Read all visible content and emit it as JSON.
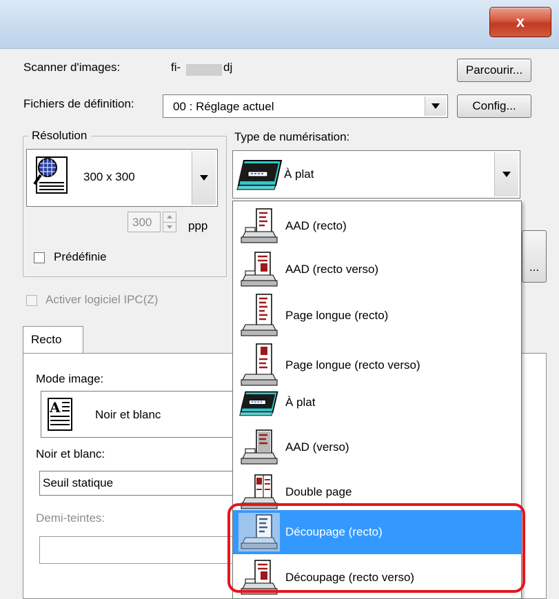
{
  "window": {
    "close_label": "x"
  },
  "scanner": {
    "label": "Scanner d'images:",
    "value_prefix": "fi-",
    "value_suffix": "dj",
    "browse_button": "Parcourir..."
  },
  "definition": {
    "label": "Fichiers de définition:",
    "value": "00 : Réglage actuel",
    "config_button": "Config..."
  },
  "resolution": {
    "group_label": "Résolution",
    "value": "300 x 300",
    "spin_value": "300",
    "unit": "ppp",
    "predefined_label": "Prédéfinie"
  },
  "scan_type": {
    "label": "Type de numérisation:",
    "value": "À plat"
  },
  "ipc": {
    "label": "Activer logiciel IPC(Z)"
  },
  "tabs": [
    {
      "label": "Recto"
    }
  ],
  "image_mode": {
    "label": "Mode image:",
    "value": "Noir et blanc"
  },
  "bw": {
    "label": "Noir et blanc:",
    "value": "Seuil statique"
  },
  "halftone": {
    "label": "Demi-teintes:",
    "value": ""
  },
  "side_button": {
    "label": "..."
  },
  "dropdown": {
    "items": [
      {
        "label": "AAD (recto)",
        "icon": "adf-simplex-icon",
        "selected": false
      },
      {
        "label": "AAD (recto verso)",
        "icon": "adf-duplex-icon",
        "selected": false
      },
      {
        "label": "Page longue (recto)",
        "icon": "long-page-simplex-icon",
        "selected": false
      },
      {
        "label": "Page longue (recto verso)",
        "icon": "long-page-duplex-icon",
        "selected": false
      },
      {
        "label": "À plat",
        "icon": "flatbed-icon",
        "selected": false
      },
      {
        "label": "AAD (verso)",
        "icon": "adf-back-icon",
        "selected": false
      },
      {
        "label": "Double page",
        "icon": "double-page-icon",
        "selected": false
      },
      {
        "label": "Découpage (recto)",
        "icon": "split-simplex-icon",
        "selected": true
      },
      {
        "label": "Découpage (recto verso)",
        "icon": "split-duplex-icon",
        "selected": false
      }
    ]
  },
  "colors": {
    "selection": "#3399ff",
    "highlight_border": "#e8141c",
    "close_button": "#c13a22"
  }
}
